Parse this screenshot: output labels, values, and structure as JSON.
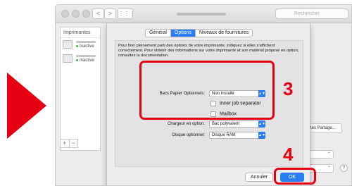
{
  "window": {
    "search_placeholder": "Rechercher",
    "nav_back_icon": "<",
    "nav_forward_icon": ">",
    "grid_icon": "⋮⋮⋮"
  },
  "printer_list": {
    "header": "Imprimantes",
    "items": [
      {
        "status": "Inactive"
      },
      {
        "status": "Inactive"
      }
    ],
    "add_symbol": "+",
    "remove_symbol": "−"
  },
  "background_panel": {
    "share_button_label": "tes Partage...",
    "help_symbol": "?"
  },
  "dialog": {
    "tabs": [
      {
        "label": "Général",
        "active": false
      },
      {
        "label": "Options",
        "active": true
      },
      {
        "label": "Niveaux de fournitures",
        "active": false
      }
    ],
    "description": "Pour tirer pleinement parti des options de votre imprimante, indiquez si elles s'affichent correctement. Pour obtenir des informations sur votre imprimante et son matériel proposé en option, consultez la documentation.",
    "fields": {
      "bacs_label": "Bacs Papier Optionnels:",
      "bacs_value": "Non Installé",
      "inner_job_separator": {
        "label": "Inner job separator",
        "checked": false
      },
      "mailbox": {
        "label": "Mailbox",
        "checked": false
      },
      "chargeur_label": "Chargeur en option:",
      "chargeur_value": "Bac polyvalent",
      "disque_label": "Disque optionnel:",
      "disque_value": "Disque RAM"
    },
    "cancel_label": "Annuler",
    "ok_label": "OK"
  },
  "annotations": {
    "step_options": "3",
    "step_ok": "4",
    "highlight_color": "#e60012"
  },
  "colors": {
    "accent_blue": "#2a7df3",
    "annotation_red": "#e60012"
  }
}
